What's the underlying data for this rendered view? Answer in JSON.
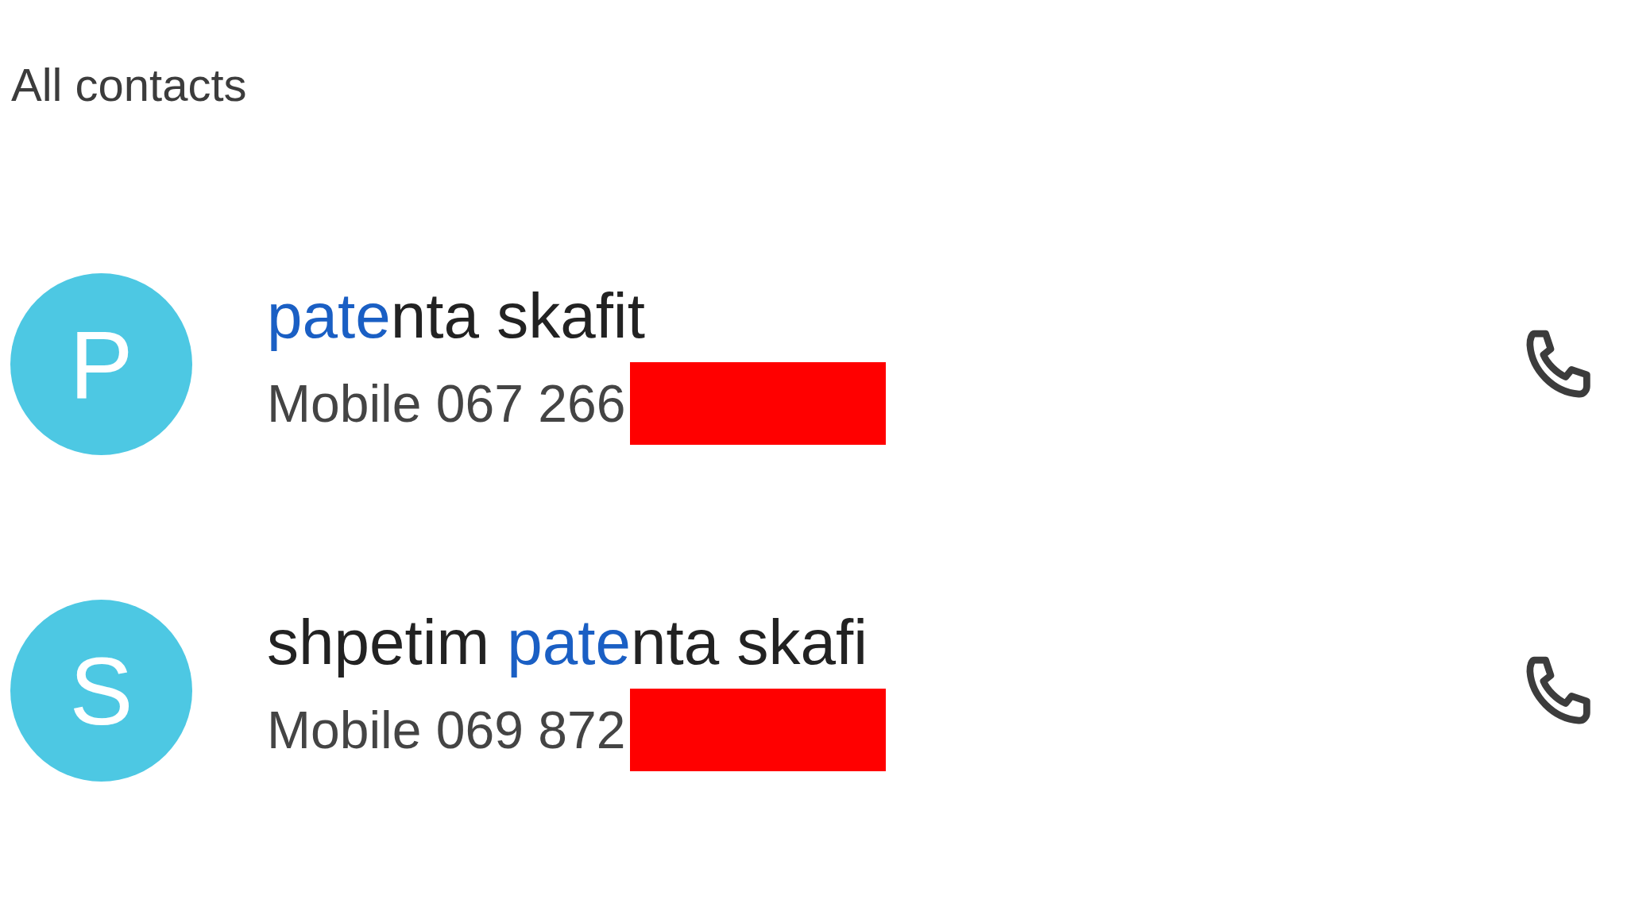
{
  "section_title": "All contacts",
  "contacts": [
    {
      "initial": "P",
      "color": "#4dc8e3",
      "name": [
        {
          "text": "pate",
          "highlighted": true
        },
        {
          "text": "nta skafit",
          "highlighted": false
        }
      ],
      "phone": "Mobile 067 266",
      "redacted": true
    },
    {
      "initial": "S",
      "color": "#4dc8e3",
      "name": [
        {
          "text": "shpetim ",
          "highlighted": false
        },
        {
          "text": "pate",
          "highlighted": true
        },
        {
          "text": "nta skafi",
          "highlighted": false
        }
      ],
      "phone": "Mobile 069 872",
      "redacted": true
    }
  ]
}
